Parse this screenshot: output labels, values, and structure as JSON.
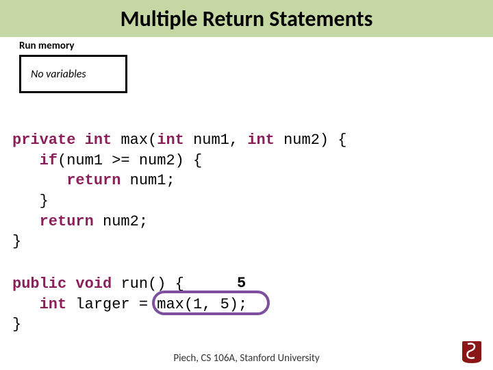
{
  "title": "Multiple Return Statements",
  "memory": {
    "label": "Run memory",
    "content": "No variables"
  },
  "code": {
    "max_line1_a": "private int ",
    "max_line1_b": "max",
    "max_line1_c": "(",
    "max_line1_d": "int ",
    "max_line1_e": "num1, ",
    "max_line1_f": "int ",
    "max_line1_g": "num2) {",
    "max_line2_a": "   if",
    "max_line2_b": "(num1 >= num2) {",
    "max_line3_a": "      return ",
    "max_line3_b": "num1;",
    "max_line4": "   }",
    "max_line5_a": "   return ",
    "max_line5_b": "num2;",
    "max_line6": "}",
    "run_line1_a": "public void ",
    "run_line1_b": "run",
    "run_line1_c": "() {",
    "run_line2_a": "   int ",
    "run_line2_b": "larger = max(1, 5);",
    "run_line3": "}"
  },
  "return_value": "5",
  "footer": "Piech, CS 106A, Stanford University",
  "colors": {
    "title_bg": "#c5d8a4",
    "keyword": "#8a1f5a",
    "oval": "#7d4f9e",
    "logo": "#8c1515"
  }
}
